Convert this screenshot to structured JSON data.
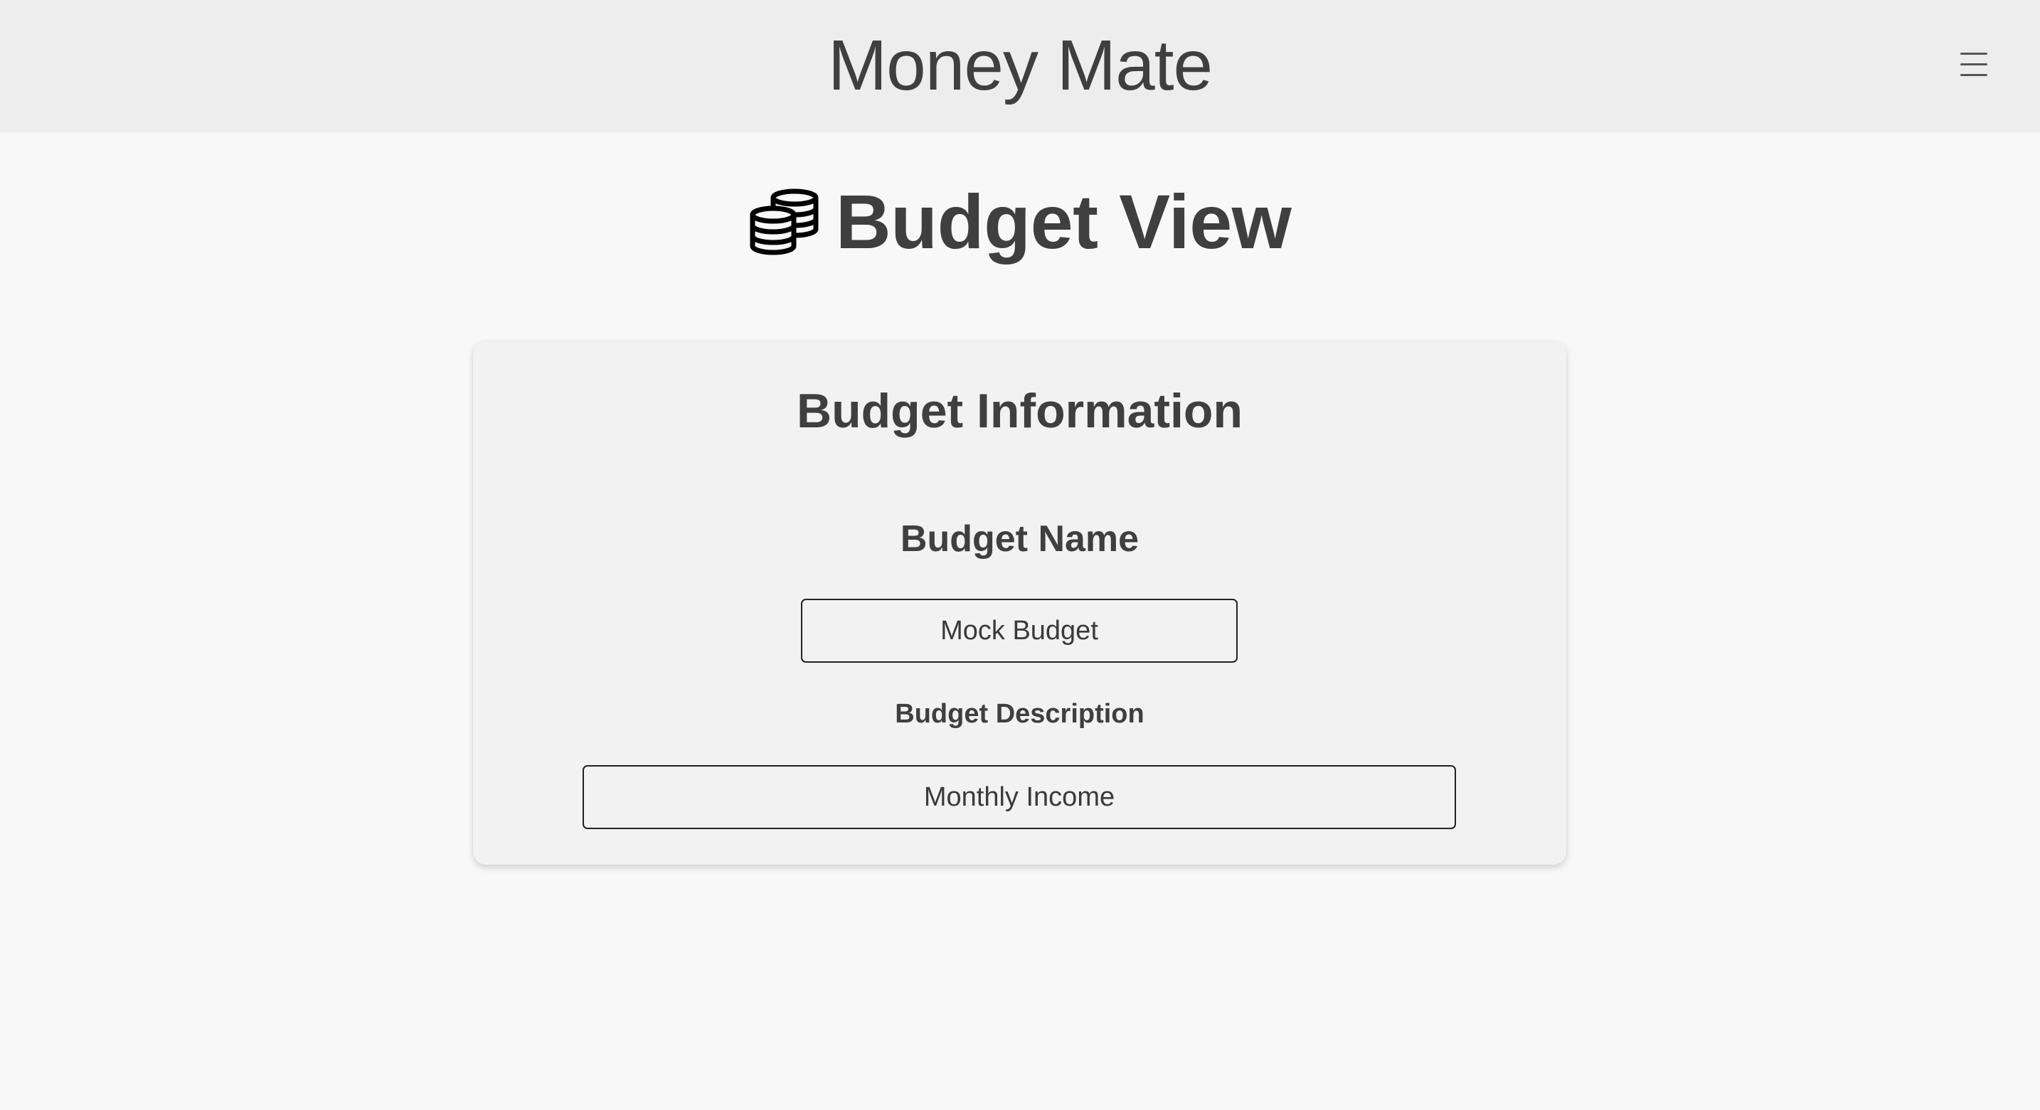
{
  "header": {
    "app_title": "Money Mate",
    "menu_icon": "hamburger-menu-icon"
  },
  "page": {
    "title": "Budget View",
    "title_icon": "coins-icon"
  },
  "budget_card": {
    "title": "Budget Information",
    "name_label": "Budget Name",
    "name_value": "Mock Budget",
    "description_label": "Budget Description",
    "description_value": "Monthly Income"
  }
}
